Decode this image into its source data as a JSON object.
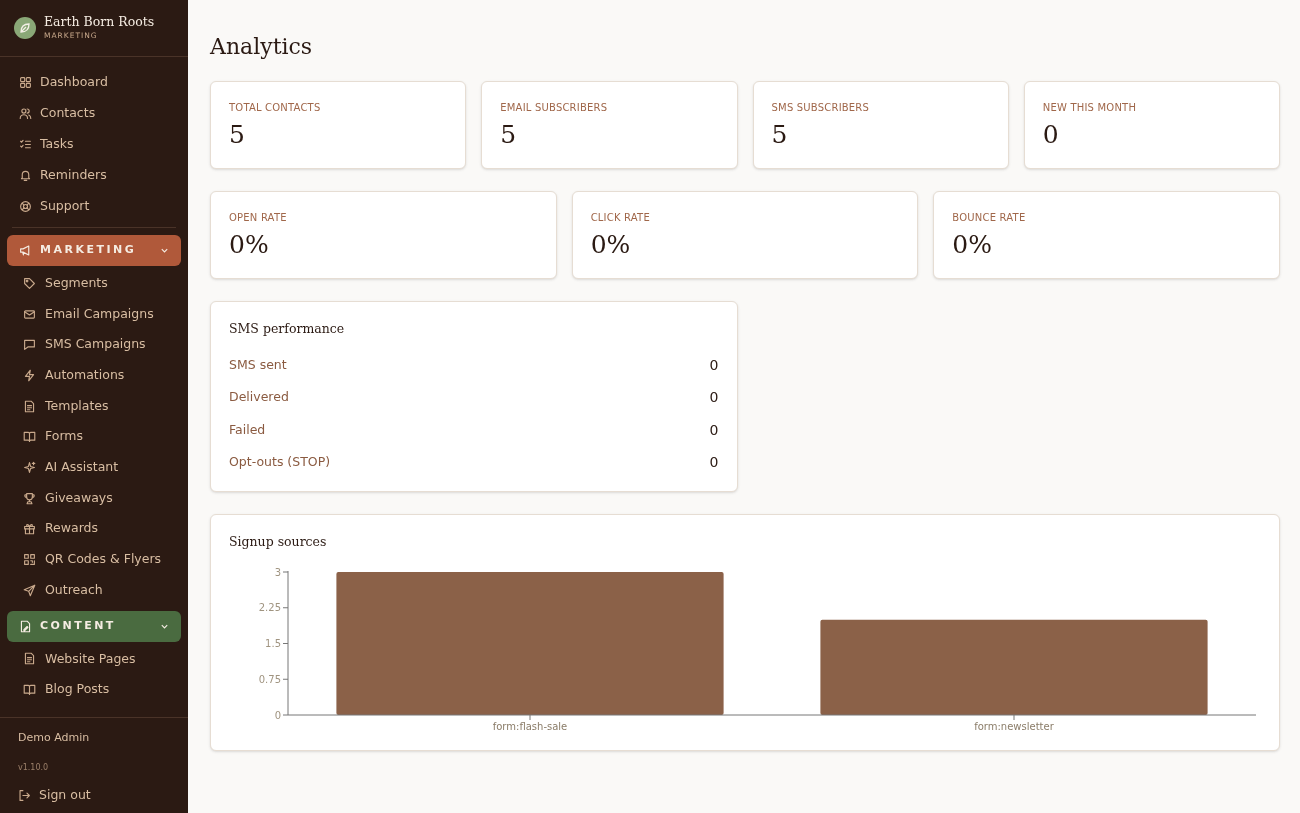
{
  "brand": {
    "name": "Earth Born Roots",
    "subtitle": "MARKETING"
  },
  "nav": [
    {
      "kind": "item",
      "label": "Dashboard"
    },
    {
      "kind": "item",
      "label": "Contacts"
    },
    {
      "kind": "item",
      "label": "Tasks"
    },
    {
      "kind": "item",
      "label": "Reminders"
    },
    {
      "kind": "item",
      "label": "Support"
    },
    {
      "kind": "section",
      "label": "MARKETING",
      "color": "#b0593a",
      "expanded": true,
      "children": [
        {
          "label": "Segments"
        },
        {
          "label": "Email Campaigns"
        },
        {
          "label": "SMS Campaigns"
        },
        {
          "label": "Automations"
        },
        {
          "label": "Templates"
        },
        {
          "label": "Forms"
        },
        {
          "label": "AI Assistant"
        },
        {
          "label": "Giveaways"
        },
        {
          "label": "Rewards"
        },
        {
          "label": "QR Codes & Flyers"
        },
        {
          "label": "Outreach"
        }
      ]
    },
    {
      "kind": "section",
      "label": "CONTENT",
      "color": "#4a6b40",
      "expanded": true,
      "children": [
        {
          "label": "Website Pages"
        },
        {
          "label": "Blog Posts"
        }
      ]
    }
  ],
  "footer": {
    "user": "Demo Admin",
    "version": "v1.10.0",
    "sign_out": "Sign out"
  },
  "title": "Analytics",
  "stats_row_1": [
    {
      "label": "TOTAL CONTACTS",
      "value": "5"
    },
    {
      "label": "EMAIL SUBSCRIBERS",
      "value": "5"
    },
    {
      "label": "SMS SUBSCRIBERS",
      "value": "5"
    },
    {
      "label": "NEW THIS MONTH",
      "value": "0"
    }
  ],
  "stats_row_2": [
    {
      "label": "OPEN RATE",
      "value": "0%"
    },
    {
      "label": "CLICK RATE",
      "value": "0%"
    },
    {
      "label": "BOUNCE RATE",
      "value": "0%"
    }
  ],
  "sms_performance": {
    "title": "SMS performance",
    "rows": [
      {
        "label": "SMS sent",
        "value": "0"
      },
      {
        "label": "Delivered",
        "value": "0"
      },
      {
        "label": "Failed",
        "value": "0"
      },
      {
        "label": "Opt-outs (STOP)",
        "value": "0"
      }
    ]
  },
  "signup_sources": {
    "title": "Signup sources",
    "chart_data": {
      "type": "bar",
      "categories": [
        "form:flash-sale",
        "form:newsletter"
      ],
      "values": [
        3,
        2
      ],
      "ylim": [
        0,
        3
      ],
      "yticks": [
        0,
        {
          "value": 0.75,
          "label": "0.75"
        },
        {
          "value": 1.5,
          "label": "1.5"
        },
        {
          "value": 2.25,
          "label": "2.25"
        },
        3
      ]
    }
  }
}
